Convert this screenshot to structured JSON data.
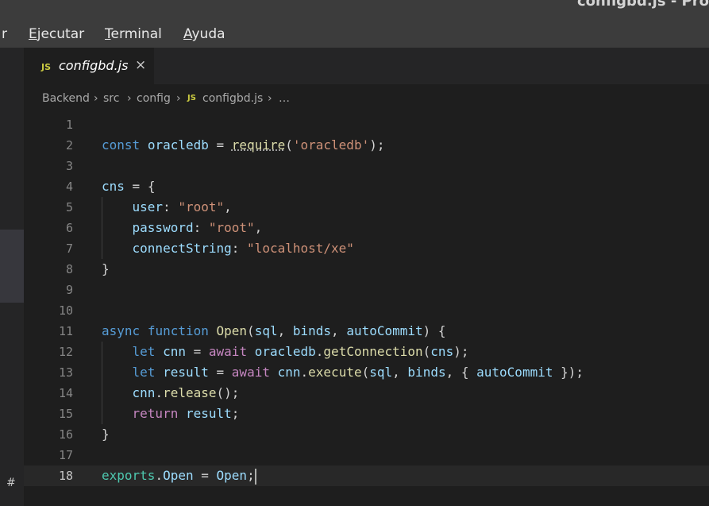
{
  "window": {
    "title": "configbd.js - Pro"
  },
  "menu": {
    "partial_first": "r",
    "items": [
      {
        "label": "Ejecutar"
      },
      {
        "label": "Terminal"
      },
      {
        "label": "Ayuda"
      }
    ]
  },
  "tab": {
    "icon_text": "JS",
    "name": "configbd.js",
    "close": "×"
  },
  "breadcrumb": {
    "separator": "›",
    "items": [
      "Backend",
      "src",
      "config"
    ],
    "file_icon_text": "JS",
    "file": "configbd.js",
    "ellipsis": "…"
  },
  "editor": {
    "current_line": 18,
    "lines": [
      {
        "n": "1"
      },
      {
        "n": "2"
      },
      {
        "n": "3"
      },
      {
        "n": "4"
      },
      {
        "n": "5"
      },
      {
        "n": "6"
      },
      {
        "n": "7"
      },
      {
        "n": "8"
      },
      {
        "n": "9"
      },
      {
        "n": "10"
      },
      {
        "n": "11"
      },
      {
        "n": "12"
      },
      {
        "n": "13"
      },
      {
        "n": "14"
      },
      {
        "n": "15"
      },
      {
        "n": "16"
      },
      {
        "n": "17"
      },
      {
        "n": "18"
      }
    ],
    "code": {
      "l2": [
        "const",
        "oracledb",
        "=",
        "require",
        "(",
        "'oracledb'",
        ");"
      ],
      "l4": [
        "cns",
        "=",
        "{"
      ],
      "l5": [
        "user",
        ":",
        "\"root\"",
        ","
      ],
      "l6": [
        "password",
        ":",
        "\"root\"",
        ","
      ],
      "l7": [
        "connectString",
        ":",
        "\"localhost/xe\""
      ],
      "l8": [
        "}"
      ],
      "l11": [
        "async",
        "function",
        "Open",
        "(",
        "sql",
        ",",
        "binds",
        ",",
        "autoCommit",
        ") {"
      ],
      "l12": [
        "let",
        "cnn",
        "=",
        "await",
        "oracledb",
        ".",
        "getConnection",
        "(",
        "cns",
        ");"
      ],
      "l13": [
        "let",
        "result",
        "=",
        "await",
        "cnn",
        ".",
        "execute",
        "(",
        "sql",
        ",",
        "binds",
        ", {",
        "autoCommit",
        "});"
      ],
      "l14": [
        "cnn",
        ".",
        "release",
        "();"
      ],
      "l15": [
        "return",
        "result",
        ";"
      ],
      "l16": [
        "}"
      ],
      "l18": [
        "exports",
        ".",
        "Open",
        "=",
        "Open",
        ";"
      ]
    }
  },
  "side": {
    "hash": "#"
  },
  "colors": {
    "keyword": "#569cd6",
    "control": "#c586c0",
    "variable": "#9cdcfe",
    "function": "#dcdcaa",
    "string": "#ce9178",
    "js_icon": "#cbcb41"
  }
}
